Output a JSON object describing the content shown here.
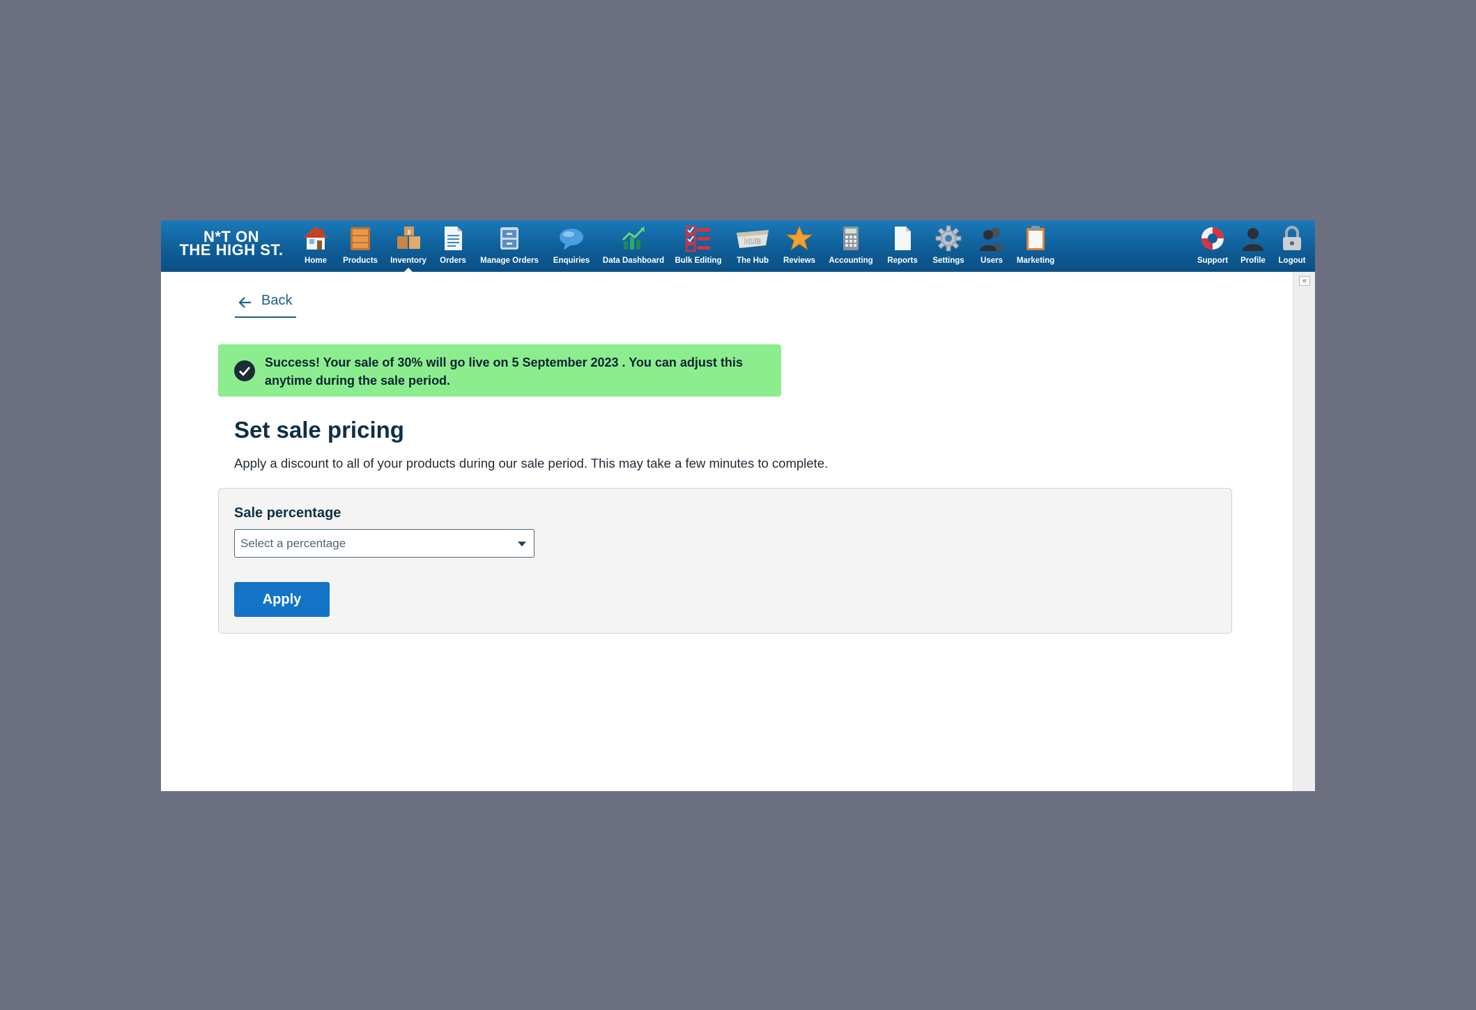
{
  "brand": {
    "line1": "N*T ON",
    "line2": "THE HIGH ST."
  },
  "nav": {
    "items": [
      {
        "label": "Home",
        "icon": "home-icon"
      },
      {
        "label": "Products",
        "icon": "products-icon"
      },
      {
        "label": "Inventory",
        "icon": "inventory-icon",
        "active": true
      },
      {
        "label": "Orders",
        "icon": "orders-icon"
      },
      {
        "label": "Manage Orders",
        "icon": "manage-orders-icon"
      },
      {
        "label": "Enquiries",
        "icon": "enquiries-icon"
      },
      {
        "label": "Data Dashboard",
        "icon": "data-dashboard-icon"
      },
      {
        "label": "Bulk Editing",
        "icon": "bulk-editing-icon"
      },
      {
        "label": "The Hub",
        "icon": "hub-icon",
        "icon_text": "HUB"
      },
      {
        "label": "Reviews",
        "icon": "reviews-icon"
      },
      {
        "label": "Accounting",
        "icon": "accounting-icon"
      },
      {
        "label": "Reports",
        "icon": "reports-icon"
      },
      {
        "label": "Settings",
        "icon": "settings-icon"
      },
      {
        "label": "Users",
        "icon": "users-icon"
      },
      {
        "label": "Marketing",
        "icon": "marketing-icon"
      }
    ],
    "right_items": [
      {
        "label": "Support",
        "icon": "support-icon"
      },
      {
        "label": "Profile",
        "icon": "profile-icon"
      },
      {
        "label": "Logout",
        "icon": "logout-icon"
      }
    ]
  },
  "sidebar": {
    "collapse_glyph": "«"
  },
  "back": {
    "label": "Back"
  },
  "success": {
    "message": "Success! Your sale of 30% will go live on 5 September 2023 . You can adjust this anytime during the sale period."
  },
  "page": {
    "title": "Set sale pricing",
    "description": "Apply a discount to all of your products during our sale period. This may take a few minutes to complete."
  },
  "form": {
    "sale_label": "Sale percentage",
    "select_placeholder": "Select a percentage",
    "apply_label": "Apply"
  },
  "colors": {
    "nav_bg": "#0f5e98",
    "success_bg": "#8ced8f",
    "primary_button": "#1373c7",
    "title_text": "#0f2f45"
  }
}
